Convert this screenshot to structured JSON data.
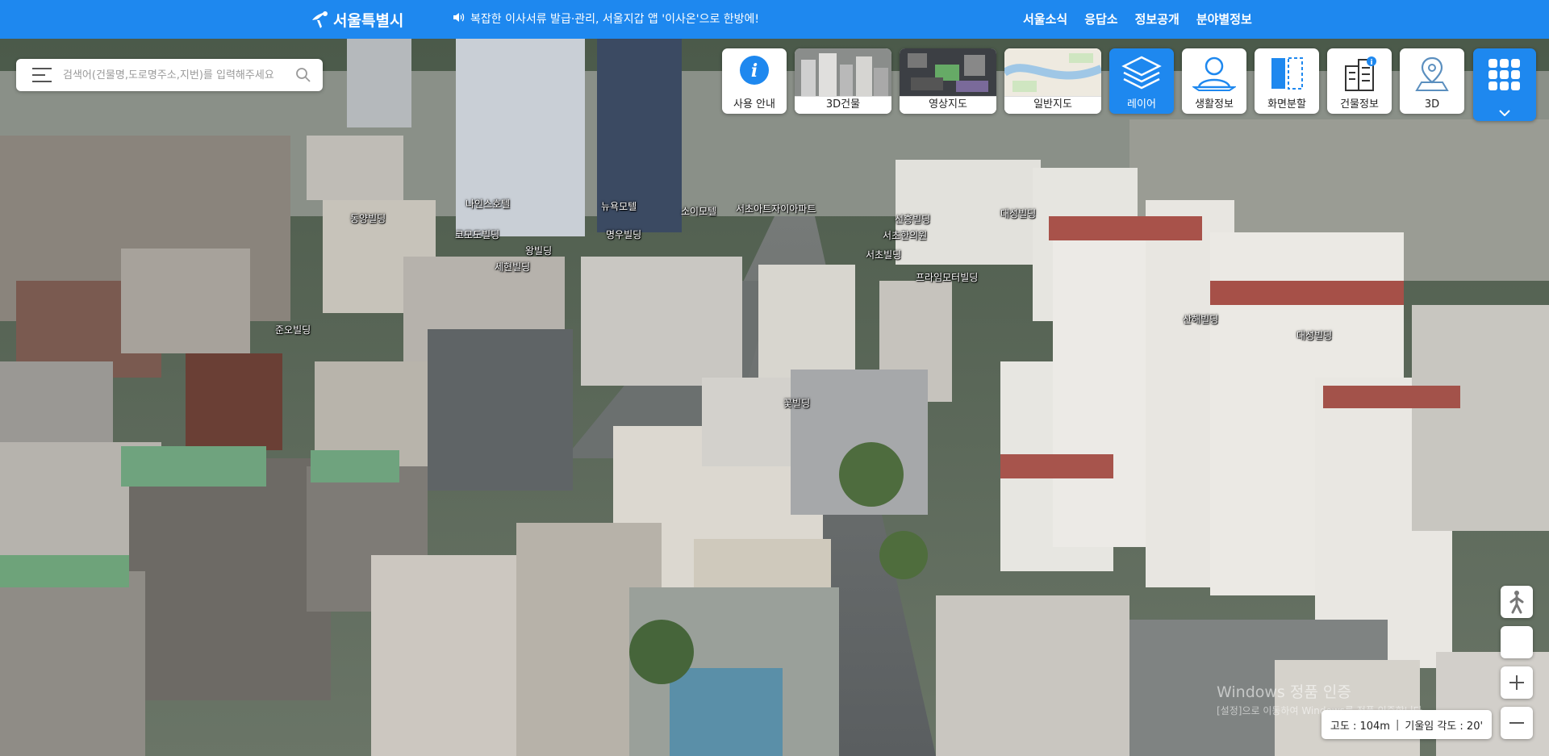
{
  "header": {
    "logo_text": "서울특별시",
    "notice": "복잡한 이사서류 발급·관리, 서울지갑 앱 '이사온'으로 한방에!",
    "nav": [
      "서울소식",
      "응답소",
      "정보공개",
      "분야별정보"
    ]
  },
  "search": {
    "placeholder": "검색어(건물명,도로명주소,지번)를 입력해주세요"
  },
  "tools": [
    {
      "label": "사용 안내",
      "icon": "info-icon"
    },
    {
      "label": "3D건물",
      "icon": "3d-building-thumbnail"
    },
    {
      "label": "영상지도",
      "icon": "satellite-thumbnail"
    },
    {
      "label": "일반지도",
      "icon": "general-map-thumbnail"
    },
    {
      "label": "레이어",
      "icon": "layers-icon",
      "active": true
    },
    {
      "label": "생활정보",
      "icon": "life-info-icon"
    },
    {
      "label": "화면분할",
      "icon": "split-screen-icon"
    },
    {
      "label": "건물정보",
      "icon": "building-info-icon"
    },
    {
      "label": "3D",
      "icon": "map-pin-icon"
    }
  ],
  "all_menu_icon": "grid-icon",
  "building_labels": [
    "동양빌딩",
    "나인스호텔",
    "코모도빌딩",
    "왕빌딩",
    "세현빌딩",
    "뉴욕모텔",
    "명우빌딩",
    "소이모텔",
    "서초아트자이아파트",
    "선흥빌딩",
    "서초한의원",
    "서초빌딩",
    "대성빌딩",
    "프라임모터빌딩",
    "준오빌딩",
    "산해빌딩",
    "대성빌딩",
    "꽃빌딩"
  ],
  "status": {
    "altitude": "고도 : 104m",
    "tilt": "기울임 각도 : 20'"
  },
  "watermark": {
    "line1": "Windows 정품 인증",
    "line2": "[설정]으로 이동하여 Windows를 정품 인증합니다."
  },
  "colors": {
    "primary": "#1e88ef",
    "header": "#1e88ef"
  }
}
